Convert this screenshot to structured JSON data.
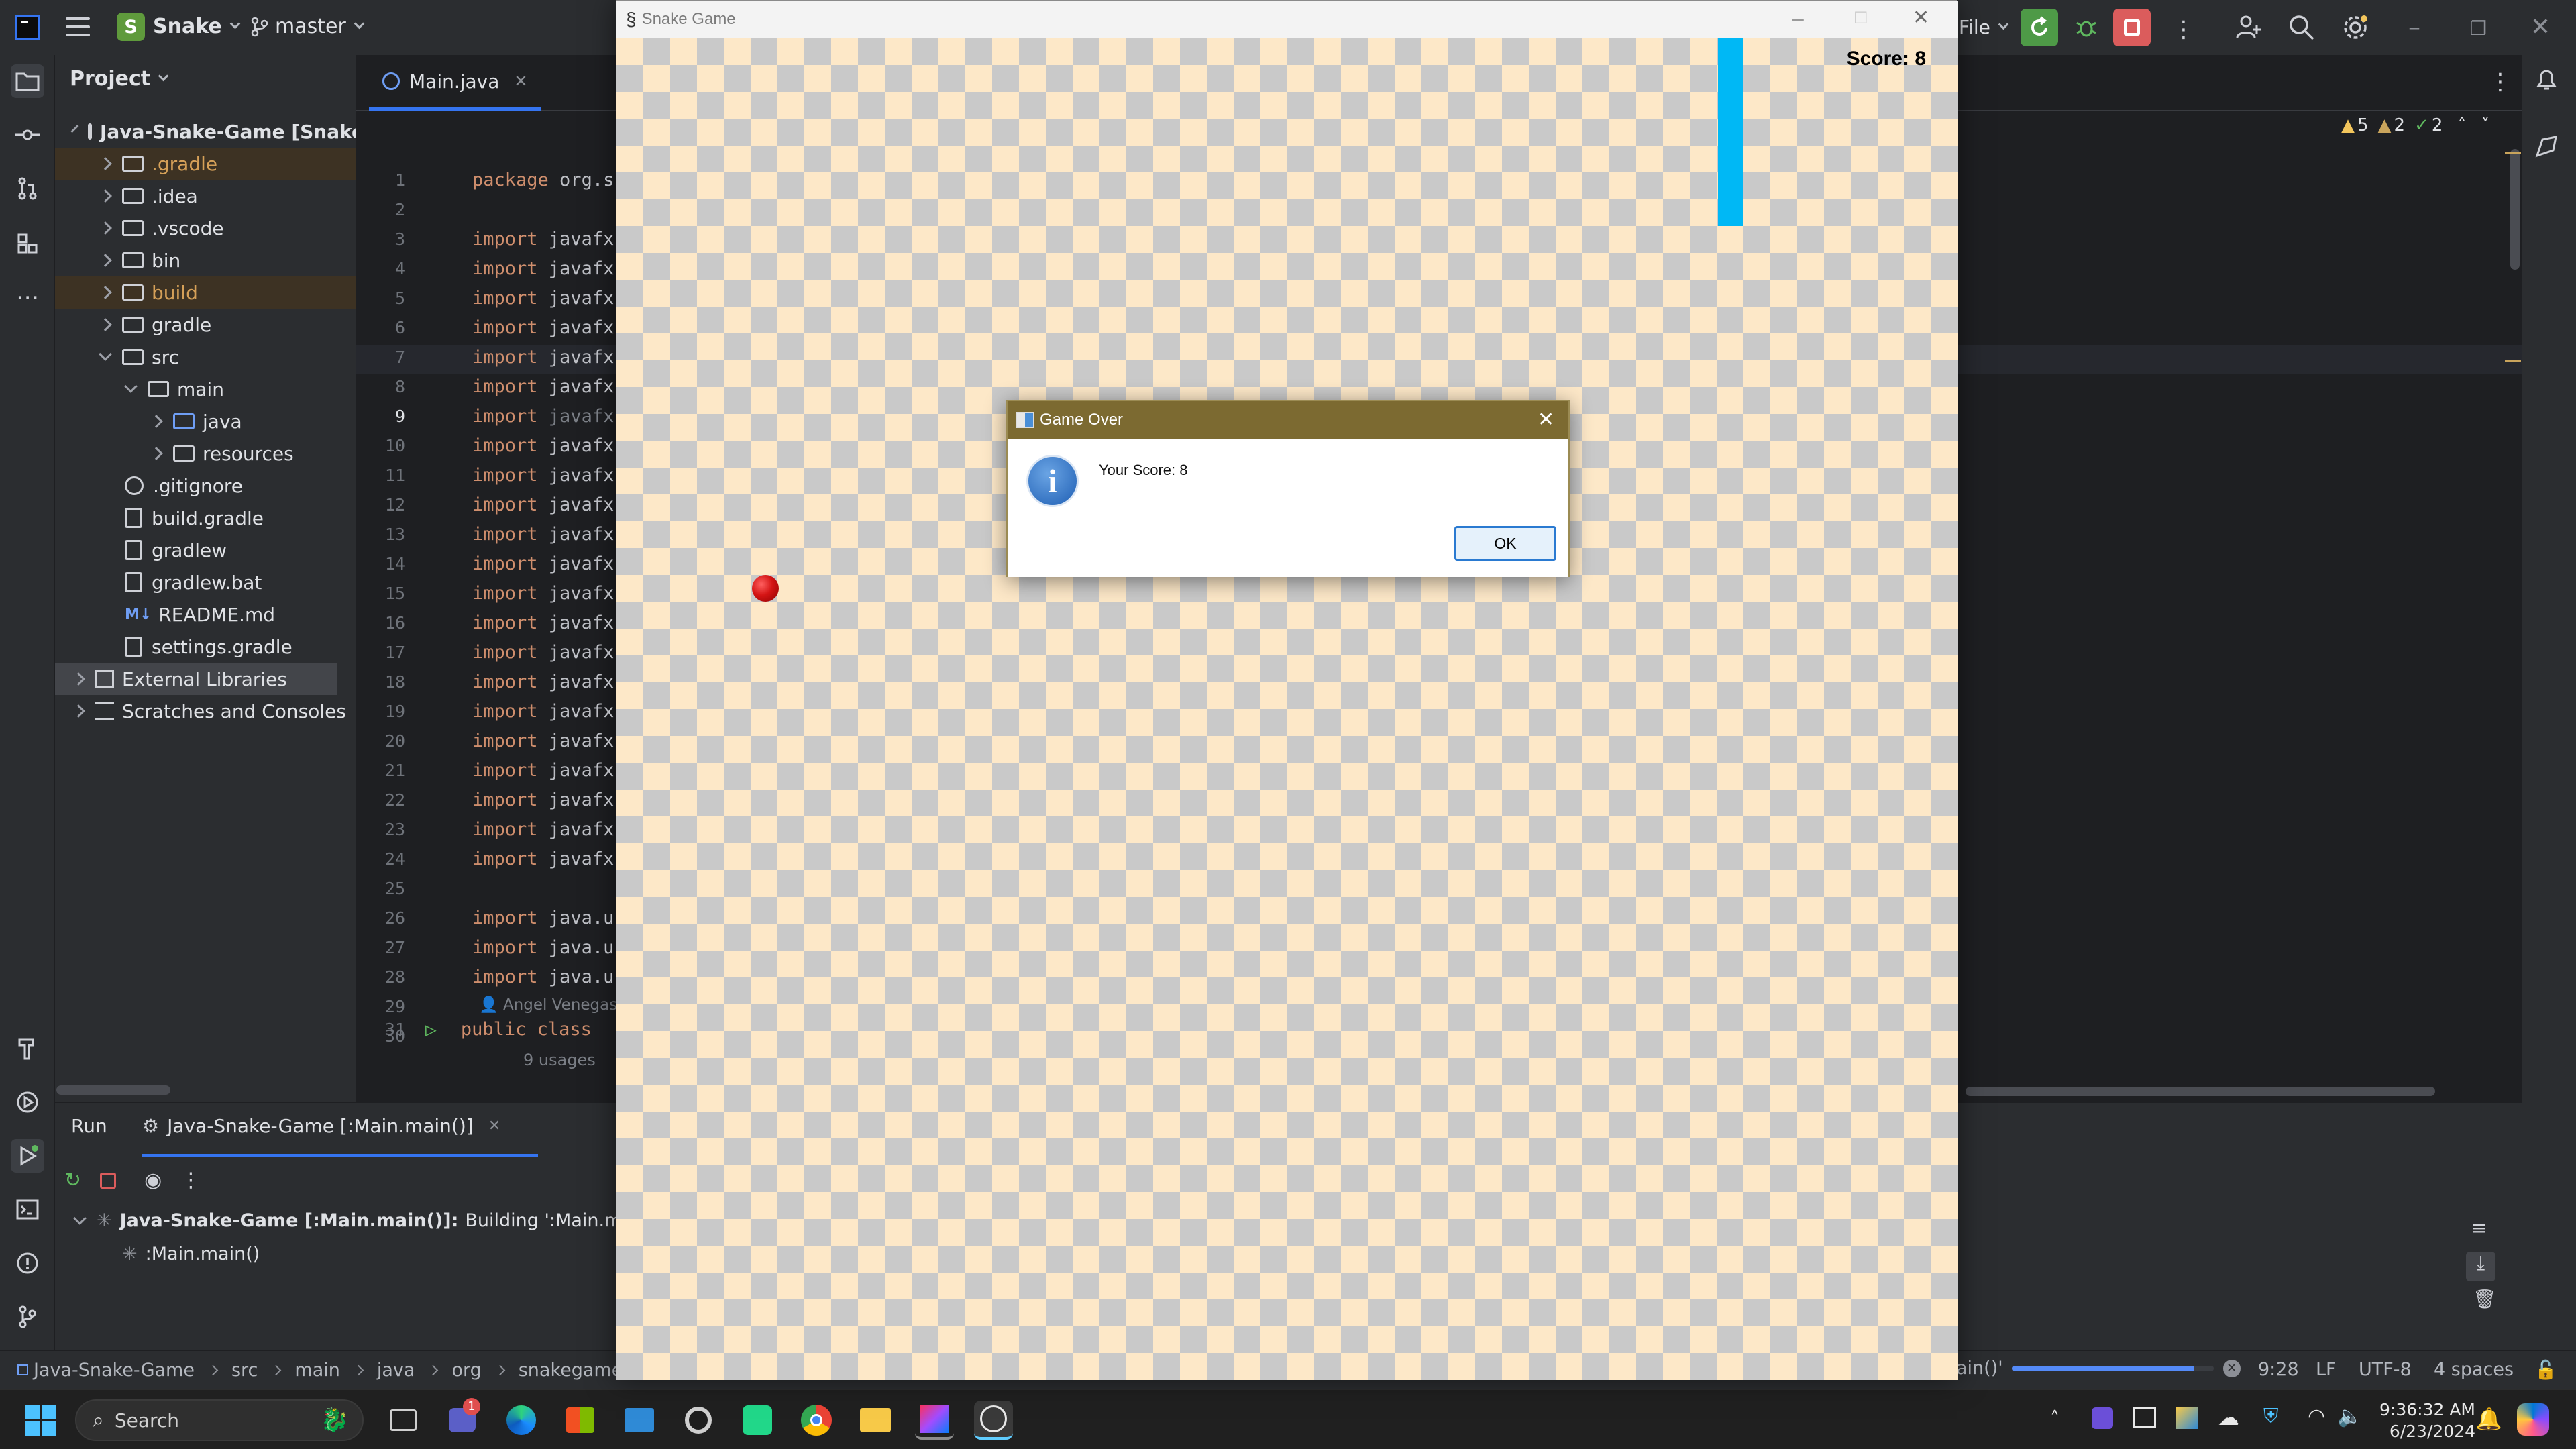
{
  "ide": {
    "project_badge": "S",
    "project_name": "Snake",
    "branch": "master",
    "file_menu": "File"
  },
  "project_pane": {
    "title": "Project",
    "tree": [
      {
        "label": "Java-Snake-Game [Snake]",
        "depth": 0
      },
      {
        "label": ".gradle",
        "depth": 1
      },
      {
        "label": ".idea",
        "depth": 1
      },
      {
        "label": ".vscode",
        "depth": 1
      },
      {
        "label": "bin",
        "depth": 1
      },
      {
        "label": "build",
        "depth": 1
      },
      {
        "label": "gradle",
        "depth": 1
      },
      {
        "label": "src",
        "depth": 1
      },
      {
        "label": "main",
        "depth": 2
      },
      {
        "label": "java",
        "depth": 3
      },
      {
        "label": "resources",
        "depth": 3
      },
      {
        "label": ".gitignore",
        "depth": 1
      },
      {
        "label": "build.gradle",
        "depth": 1
      },
      {
        "label": "gradlew",
        "depth": 1
      },
      {
        "label": "gradlew.bat",
        "depth": 1
      },
      {
        "label": "README.md",
        "depth": 1
      },
      {
        "label": "settings.gradle",
        "depth": 1
      },
      {
        "label": "External Libraries",
        "depth": 0
      },
      {
        "label": "Scratches and Consoles",
        "depth": 0
      }
    ],
    "readme_badge": "M↓"
  },
  "editor": {
    "tab": "Main.java",
    "inspections": {
      "warnings": "5",
      "weak": "2",
      "ok": "2"
    },
    "lines": [
      {
        "n": "1",
        "text": "package org.s"
      },
      {
        "n": "2",
        "text": ""
      },
      {
        "n": "3",
        "text": "import javafx"
      },
      {
        "n": "4",
        "text": "import javafx"
      },
      {
        "n": "5",
        "text": "import javafx"
      },
      {
        "n": "6",
        "text": "import javafx"
      },
      {
        "n": "7",
        "text": "import javafx"
      },
      {
        "n": "8",
        "text": "import javafx"
      },
      {
        "n": "9",
        "text": "import javafx"
      },
      {
        "n": "10",
        "text": "import javafx"
      },
      {
        "n": "11",
        "text": "import javafx"
      },
      {
        "n": "12",
        "text": "import javafx"
      },
      {
        "n": "13",
        "text": "import javafx"
      },
      {
        "n": "14",
        "text": "import javafx"
      },
      {
        "n": "15",
        "text": "import javafx"
      },
      {
        "n": "16",
        "text": "import javafx"
      },
      {
        "n": "17",
        "text": "import javafx"
      },
      {
        "n": "18",
        "text": "import javafx"
      },
      {
        "n": "19",
        "text": "import javafx"
      },
      {
        "n": "20",
        "text": "import javafx"
      },
      {
        "n": "21",
        "text": "import javafx"
      },
      {
        "n": "22",
        "text": "import javafx"
      },
      {
        "n": "23",
        "text": "import javafx"
      },
      {
        "n": "24",
        "text": "import javafx"
      },
      {
        "n": "25",
        "text": ""
      },
      {
        "n": "26",
        "text": "import java.u"
      },
      {
        "n": "27",
        "text": "import java.u"
      },
      {
        "n": "28",
        "text": "import java.u"
      },
      {
        "n": "29",
        "text": ""
      },
      {
        "n": "30",
        "text": ""
      }
    ],
    "author_hint": "Angel Venegas",
    "line31_num": "31",
    "line31": "public class",
    "usages": "9 usages"
  },
  "run_panel": {
    "title": "Run",
    "config_tab": "Java-Snake-Game [:Main.main()]",
    "build_line_bold": "Java-Snake-Game [:Main.main()]:",
    "build_line_rest": "Building ':Main.main()'",
    "task": ":Main.main()"
  },
  "status_bar": {
    "breadcrumbs": [
      "Java-Snake-Game",
      "src",
      "main",
      "java",
      "org",
      "snakegame"
    ],
    "task_tail": "ain()'",
    "progress_fraction": 0.9,
    "caret": "9:28",
    "line_sep": "LF",
    "encoding": "UTF-8",
    "indent": "4 spaces"
  },
  "snake_game": {
    "window_title": "Snake Game",
    "score_label": "Score: 8"
  },
  "dialog": {
    "title": "Game Over",
    "message": "Your Score: 8",
    "ok": "OK"
  },
  "taskbar": {
    "search_placeholder": "Search",
    "teams_badge": "1",
    "time": "9:36:32 AM",
    "date": "6/23/2024"
  },
  "colors": {
    "snake": "#00b8f5",
    "apple": "#d41414",
    "accent": "#3574f0",
    "dialog_title": "#7c6a31"
  }
}
